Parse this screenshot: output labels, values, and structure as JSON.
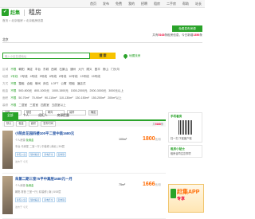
{
  "topnav": {
    "items": [
      "首页",
      "发布",
      "免费",
      "我的",
      "招聘",
      "租房",
      "二手房",
      "帮助",
      "站长"
    ]
  },
  "header": {
    "logo_mark": "✓",
    "site": "赶集",
    "channel": "租房"
  },
  "breadcrumb": "首页 > 北京租房 > 北京租房信息",
  "publish_label": "免费发布房源",
  "stats": {
    "prefix": "共有",
    "count": "5168",
    "suffix": "条租房信息，今日新增",
    "today": "1356",
    "tail": "条"
  },
  "city_row": "北京",
  "search": {
    "placeholder": "输入小区名或地址",
    "button": "搜 索",
    "map_label": "地图找房"
  },
  "filters": [
    {
      "key": "区域",
      "values": [
        "不限",
        "朝阳",
        "海淀",
        "丰台",
        "东城",
        "西城",
        "石景山",
        "通州",
        "大兴",
        "顺义",
        "昌平",
        "房山",
        "门头沟"
      ]
    },
    {
      "key": "地铁",
      "values": [
        "1号线",
        "2号线",
        "4号线",
        "5号线",
        "6号线",
        "8号线",
        "10号线",
        "13号线",
        "15号线"
      ]
    },
    {
      "key": "方式",
      "values": [
        "不限",
        "整租",
        "合租",
        "单间",
        "床位",
        "LOFT",
        "公寓",
        "短租",
        "酒店式"
      ]
    },
    {
      "key": "租金",
      "values": [
        "不限",
        "500-800元",
        "800-1000元",
        "1000-1500元",
        "1500-2000元",
        "2000-3000元",
        "3000元以上"
      ]
    },
    {
      "key": "面积",
      "values": [
        "不限",
        "50-70m²",
        "70-90m²",
        "90-110m²",
        "110-130m²",
        "130-150m²",
        "150-200m²",
        "200m²以上"
      ]
    },
    {
      "key": "装修",
      "values": [
        "不限",
        "二居室",
        "三居室",
        "四居室",
        "五居室以上"
      ]
    }
  ],
  "selects": {
    "type": "户型",
    "floor": "楼层",
    "orient": "朝向",
    "decor": "装修",
    "ok": "确定"
  },
  "tabs": [
    "全部",
    "个人",
    "经纪人",
    "房源提醒"
  ],
  "sortbar": {
    "items": [
      "默认",
      "租金",
      "面积",
      "发布时间"
    ],
    "count_prefix": "共",
    "count": "5168",
    "count_suffix": "条"
  },
  "listings": [
    {
      "title": "小院此花园四楼100平二室中装1680元",
      "tag": "个人房源",
      "tag_green": "免佣金",
      "desc": "丰台-马家堡 二室一厅 | 中装修 | 南北 | 3/6层",
      "feats": [
        "拎包入住",
        "随时看房",
        "家电齐全",
        "近地铁"
      ],
      "area": "100m²",
      "price": "1800",
      "unit": "元/月",
      "foot": "发布于 今天"
    },
    {
      "title": "朱第二期三室75平中高层1680元一月",
      "tag": "个人房源",
      "tag_green": "免佣金",
      "desc": "朝阳-常营 三室一厅 | 精装修 | 南 | 8/18层",
      "feats": [
        "拎包入住",
        "随时看房",
        "家电齐全",
        "近地铁"
      ],
      "area": "75m²",
      "price": "1666",
      "unit": "元/月",
      "foot": "发布于 今天"
    }
  ],
  "side": {
    "app_title": "手机看房",
    "app_sub": "扫一扫 下载客户端",
    "help_title": "租房小贴士",
    "help_sub": "租房合同注意事项"
  },
  "promo": {
    "big": "赶集APP",
    "sub": "专享"
  }
}
